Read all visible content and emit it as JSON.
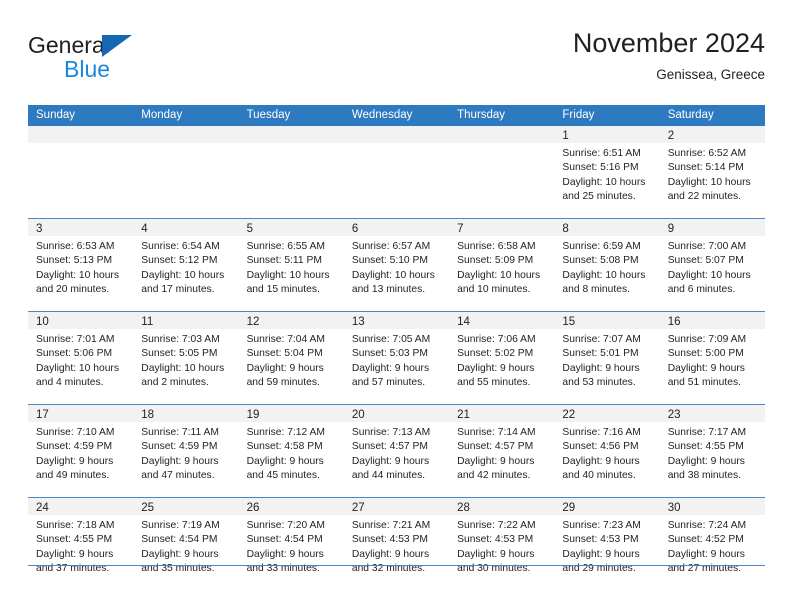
{
  "brand": {
    "word_general": "General",
    "word_blue": "Blue",
    "triangle_color": "#1667b2",
    "blue_text_color": "#1b87dc"
  },
  "header": {
    "title": "November 2024",
    "location": "Genissea, Greece"
  },
  "theme": {
    "header_band": "#2e7ac0",
    "row_rule": "#4a87c4",
    "daynum_band": "#f2f2f2",
    "text": "#231f20"
  },
  "weekday_headers": [
    "Sunday",
    "Monday",
    "Tuesday",
    "Wednesday",
    "Thursday",
    "Friday",
    "Saturday"
  ],
  "weeks": [
    [
      {
        "day": "",
        "lines": []
      },
      {
        "day": "",
        "lines": []
      },
      {
        "day": "",
        "lines": []
      },
      {
        "day": "",
        "lines": []
      },
      {
        "day": "",
        "lines": []
      },
      {
        "day": "1",
        "lines": [
          "Sunrise: 6:51 AM",
          "Sunset: 5:16 PM",
          "Daylight: 10 hours",
          "and 25 minutes."
        ]
      },
      {
        "day": "2",
        "lines": [
          "Sunrise: 6:52 AM",
          "Sunset: 5:14 PM",
          "Daylight: 10 hours",
          "and 22 minutes."
        ]
      }
    ],
    [
      {
        "day": "3",
        "lines": [
          "Sunrise: 6:53 AM",
          "Sunset: 5:13 PM",
          "Daylight: 10 hours",
          "and 20 minutes."
        ]
      },
      {
        "day": "4",
        "lines": [
          "Sunrise: 6:54 AM",
          "Sunset: 5:12 PM",
          "Daylight: 10 hours",
          "and 17 minutes."
        ]
      },
      {
        "day": "5",
        "lines": [
          "Sunrise: 6:55 AM",
          "Sunset: 5:11 PM",
          "Daylight: 10 hours",
          "and 15 minutes."
        ]
      },
      {
        "day": "6",
        "lines": [
          "Sunrise: 6:57 AM",
          "Sunset: 5:10 PM",
          "Daylight: 10 hours",
          "and 13 minutes."
        ]
      },
      {
        "day": "7",
        "lines": [
          "Sunrise: 6:58 AM",
          "Sunset: 5:09 PM",
          "Daylight: 10 hours",
          "and 10 minutes."
        ]
      },
      {
        "day": "8",
        "lines": [
          "Sunrise: 6:59 AM",
          "Sunset: 5:08 PM",
          "Daylight: 10 hours",
          "and 8 minutes."
        ]
      },
      {
        "day": "9",
        "lines": [
          "Sunrise: 7:00 AM",
          "Sunset: 5:07 PM",
          "Daylight: 10 hours",
          "and 6 minutes."
        ]
      }
    ],
    [
      {
        "day": "10",
        "lines": [
          "Sunrise: 7:01 AM",
          "Sunset: 5:06 PM",
          "Daylight: 10 hours",
          "and 4 minutes."
        ]
      },
      {
        "day": "11",
        "lines": [
          "Sunrise: 7:03 AM",
          "Sunset: 5:05 PM",
          "Daylight: 10 hours",
          "and 2 minutes."
        ]
      },
      {
        "day": "12",
        "lines": [
          "Sunrise: 7:04 AM",
          "Sunset: 5:04 PM",
          "Daylight: 9 hours",
          "and 59 minutes."
        ]
      },
      {
        "day": "13",
        "lines": [
          "Sunrise: 7:05 AM",
          "Sunset: 5:03 PM",
          "Daylight: 9 hours",
          "and 57 minutes."
        ]
      },
      {
        "day": "14",
        "lines": [
          "Sunrise: 7:06 AM",
          "Sunset: 5:02 PM",
          "Daylight: 9 hours",
          "and 55 minutes."
        ]
      },
      {
        "day": "15",
        "lines": [
          "Sunrise: 7:07 AM",
          "Sunset: 5:01 PM",
          "Daylight: 9 hours",
          "and 53 minutes."
        ]
      },
      {
        "day": "16",
        "lines": [
          "Sunrise: 7:09 AM",
          "Sunset: 5:00 PM",
          "Daylight: 9 hours",
          "and 51 minutes."
        ]
      }
    ],
    [
      {
        "day": "17",
        "lines": [
          "Sunrise: 7:10 AM",
          "Sunset: 4:59 PM",
          "Daylight: 9 hours",
          "and 49 minutes."
        ]
      },
      {
        "day": "18",
        "lines": [
          "Sunrise: 7:11 AM",
          "Sunset: 4:59 PM",
          "Daylight: 9 hours",
          "and 47 minutes."
        ]
      },
      {
        "day": "19",
        "lines": [
          "Sunrise: 7:12 AM",
          "Sunset: 4:58 PM",
          "Daylight: 9 hours",
          "and 45 minutes."
        ]
      },
      {
        "day": "20",
        "lines": [
          "Sunrise: 7:13 AM",
          "Sunset: 4:57 PM",
          "Daylight: 9 hours",
          "and 44 minutes."
        ]
      },
      {
        "day": "21",
        "lines": [
          "Sunrise: 7:14 AM",
          "Sunset: 4:57 PM",
          "Daylight: 9 hours",
          "and 42 minutes."
        ]
      },
      {
        "day": "22",
        "lines": [
          "Sunrise: 7:16 AM",
          "Sunset: 4:56 PM",
          "Daylight: 9 hours",
          "and 40 minutes."
        ]
      },
      {
        "day": "23",
        "lines": [
          "Sunrise: 7:17 AM",
          "Sunset: 4:55 PM",
          "Daylight: 9 hours",
          "and 38 minutes."
        ]
      }
    ],
    [
      {
        "day": "24",
        "lines": [
          "Sunrise: 7:18 AM",
          "Sunset: 4:55 PM",
          "Daylight: 9 hours",
          "and 37 minutes."
        ]
      },
      {
        "day": "25",
        "lines": [
          "Sunrise: 7:19 AM",
          "Sunset: 4:54 PM",
          "Daylight: 9 hours",
          "and 35 minutes."
        ]
      },
      {
        "day": "26",
        "lines": [
          "Sunrise: 7:20 AM",
          "Sunset: 4:54 PM",
          "Daylight: 9 hours",
          "and 33 minutes."
        ]
      },
      {
        "day": "27",
        "lines": [
          "Sunrise: 7:21 AM",
          "Sunset: 4:53 PM",
          "Daylight: 9 hours",
          "and 32 minutes."
        ]
      },
      {
        "day": "28",
        "lines": [
          "Sunrise: 7:22 AM",
          "Sunset: 4:53 PM",
          "Daylight: 9 hours",
          "and 30 minutes."
        ]
      },
      {
        "day": "29",
        "lines": [
          "Sunrise: 7:23 AM",
          "Sunset: 4:53 PM",
          "Daylight: 9 hours",
          "and 29 minutes."
        ]
      },
      {
        "day": "30",
        "lines": [
          "Sunrise: 7:24 AM",
          "Sunset: 4:52 PM",
          "Daylight: 9 hours",
          "and 27 minutes."
        ]
      }
    ]
  ]
}
